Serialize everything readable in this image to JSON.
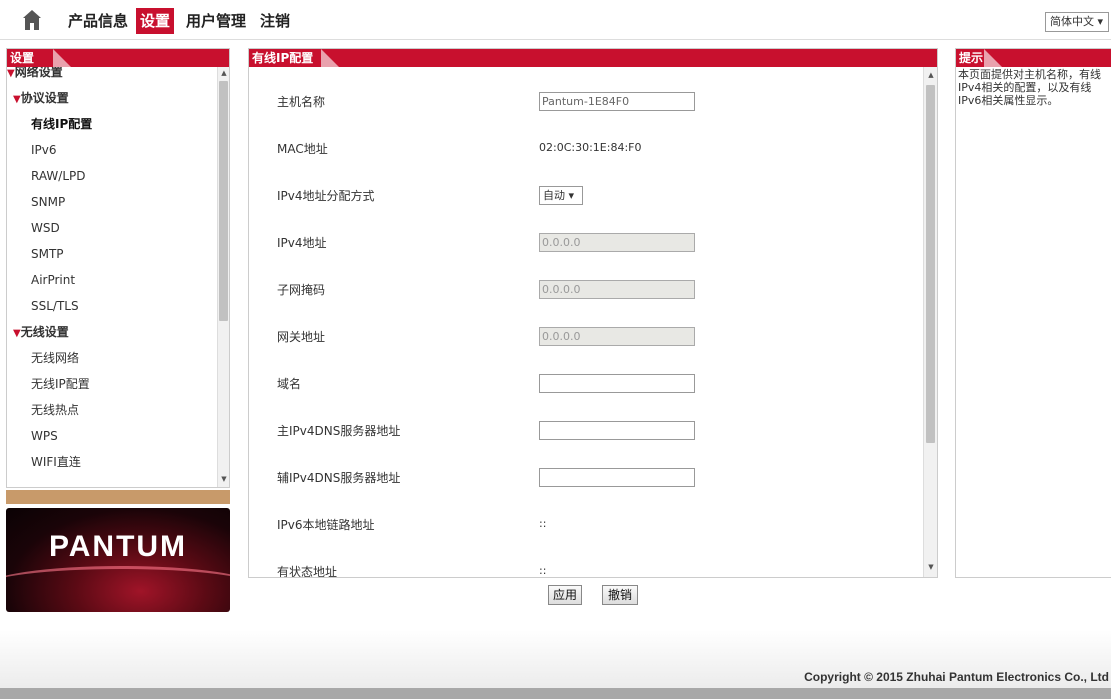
{
  "nav": {
    "items": [
      {
        "label": "产品信息",
        "active": false
      },
      {
        "label": "设置",
        "active": true
      },
      {
        "label": "用户管理",
        "active": false
      },
      {
        "label": "注销",
        "active": false
      }
    ],
    "language": "简体中文 ▾"
  },
  "sidebar": {
    "title": "设置",
    "items": [
      {
        "label": "网络设置",
        "level": 0,
        "expanded": true
      },
      {
        "label": "协议设置",
        "level": 1,
        "expanded": true
      },
      {
        "label": "有线IP配置",
        "level": 2,
        "current": true
      },
      {
        "label": "IPv6",
        "level": 2
      },
      {
        "label": "RAW/LPD",
        "level": 2
      },
      {
        "label": "SNMP",
        "level": 2
      },
      {
        "label": "WSD",
        "level": 2
      },
      {
        "label": "SMTP",
        "level": 2
      },
      {
        "label": "AirPrint",
        "level": 2
      },
      {
        "label": "SSL/TLS",
        "level": 2
      },
      {
        "label": "无线设置",
        "level": 1,
        "expanded": true
      },
      {
        "label": "无线网络",
        "level": 2
      },
      {
        "label": "无线IP配置",
        "level": 2
      },
      {
        "label": "无线热点",
        "level": 2
      },
      {
        "label": "WPS",
        "level": 2
      },
      {
        "label": "WIFI直连",
        "level": 2
      }
    ]
  },
  "logo": {
    "text": "PANTUM"
  },
  "main": {
    "title": "有线IP配置",
    "fields": [
      {
        "label": "主机名称",
        "type": "input",
        "value": "Pantum-1E84F0"
      },
      {
        "label": "MAC地址",
        "type": "text",
        "value": "02:0C:30:1E:84:F0"
      },
      {
        "label": "IPv4地址分配方式",
        "type": "select",
        "value": "自动 ▾"
      },
      {
        "label": "IPv4地址",
        "type": "input-disabled",
        "value": "0.0.0.0"
      },
      {
        "label": "子网掩码",
        "type": "input-disabled",
        "value": "0.0.0.0"
      },
      {
        "label": "网关地址",
        "type": "input-disabled",
        "value": "0.0.0.0"
      },
      {
        "label": "域名",
        "type": "input",
        "value": ""
      },
      {
        "label": "主IPv4DNS服务器地址",
        "type": "input",
        "value": ""
      },
      {
        "label": "辅IPv4DNS服务器地址",
        "type": "input",
        "value": ""
      },
      {
        "label": "IPv6本地链路地址",
        "type": "text",
        "value": "::"
      },
      {
        "label": "有状态地址",
        "type": "text",
        "value": "::"
      }
    ],
    "apply_label": "应用",
    "cancel_label": "撤销"
  },
  "hint": {
    "title": "提示",
    "text": "本页面提供对主机名称，有线IPv4相关的配置，以及有线IPv6相关属性显示。"
  },
  "footer": {
    "copyright": "Copyright © 2015 Zhuhai Pantum Electronics Co., Ltd"
  },
  "colors": {
    "accent": "#c8102e",
    "tan": "#c89a6a"
  }
}
